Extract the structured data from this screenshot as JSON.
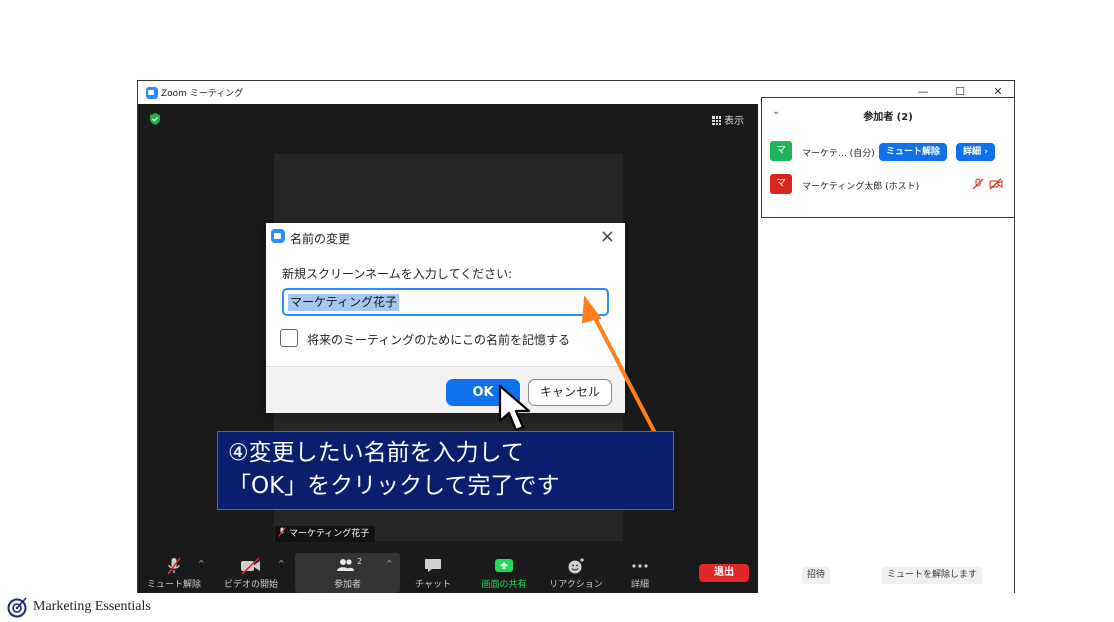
{
  "window": {
    "title": "Zoom ミーティング",
    "controls": [
      "—",
      "☐",
      "✕"
    ]
  },
  "video": {
    "view_label": "表示",
    "tile_name": "マーケティング花子"
  },
  "toolbar": {
    "mute_label": "ミュート解除",
    "video_label": "ビデオの開始",
    "participants_label": "参加者",
    "participants_count": "2",
    "chat_label": "チャット",
    "share_label": "画面の共有",
    "reactions_label": "リアクション",
    "more_label": "詳細",
    "leave_label": "退出",
    "share_color": "#23d959",
    "leave_color": "#e02828"
  },
  "panel": {
    "header": "参加者 (2)",
    "participants": [
      {
        "avatar": "マ",
        "name": "マーケテ… (自分)",
        "avatar_color": "#1fb35a",
        "unmute_label": "ミュート解除",
        "more_label": "詳細 ›"
      },
      {
        "avatar": "マ",
        "name": "マーケティング太郎 (ホスト)",
        "avatar_color": "#d8261c"
      }
    ],
    "invite_label": "招待",
    "unmute_all_label": "ミュートを解除します"
  },
  "dialog": {
    "title": "名前の変更",
    "prompt": "新規スクリーンネームを入力してください:",
    "name_value": "マーケティング花子",
    "remember_label": "将来のミーティングのためにこの名前を記憶する",
    "remember_checked": false,
    "ok_label": "OK",
    "cancel_label": "キャンセル"
  },
  "annotation": {
    "line1": "④変更したい名前を入力して",
    "line2": "「OK」をクリックして完了です",
    "arrow_color": "#ff7f1e",
    "box_color": "#0a1e6e"
  },
  "brand": {
    "name": "Marketing Essentials"
  }
}
